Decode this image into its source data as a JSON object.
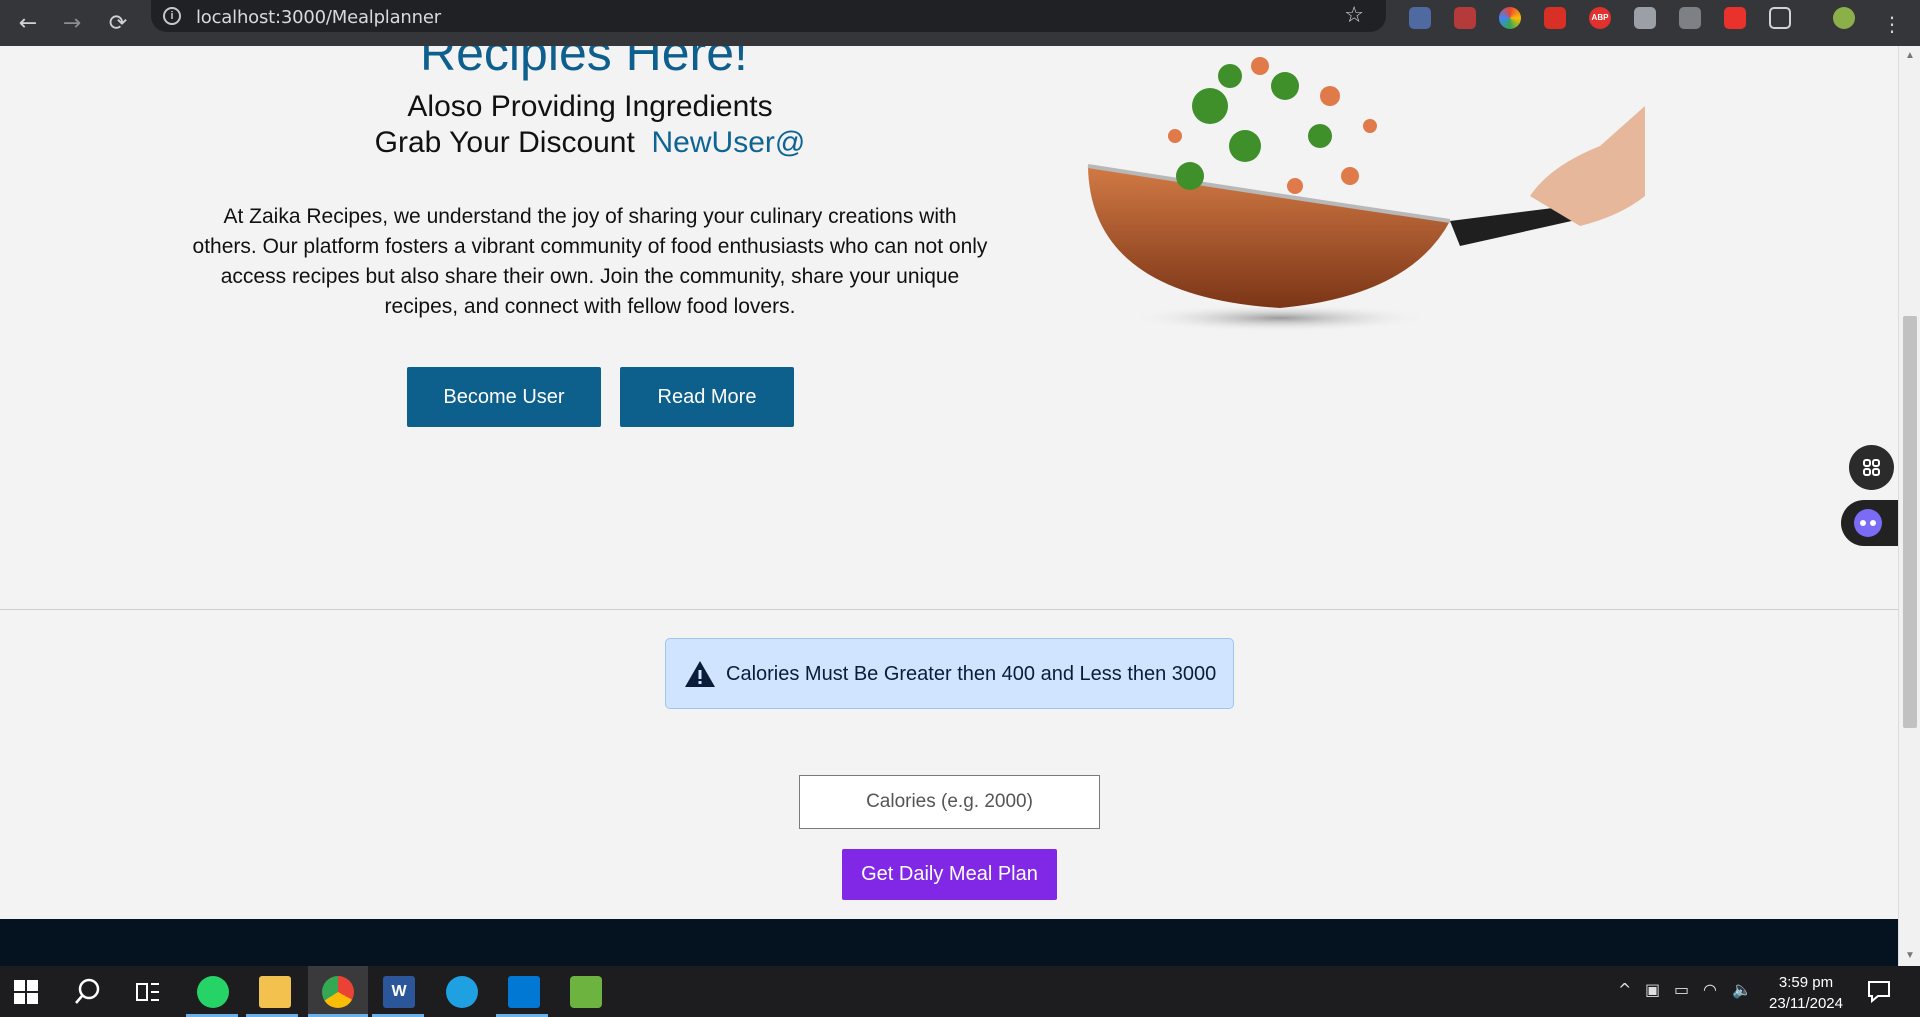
{
  "browser": {
    "url": "localhost:3000/Mealplanner",
    "back_icon": "arrow-left-icon",
    "forward_icon": "arrow-right-icon",
    "reload_icon": "reload-icon",
    "bookmark_icon": "star-icon"
  },
  "hero": {
    "title_partial": "Recipies Here!",
    "subtitle_line1": "Aloso Providing Ingredients",
    "subtitle_line2_prefix": "Grab Your Discount ",
    "subtitle_line2_code": "NewUser@",
    "paragraph": "At Zaika Recipes, we understand the joy of sharing your culinary creations with others. Our platform fosters a vibrant community of food enthusiasts who can not only access recipes but also share their own. Join the community, share your unique recipes, and connect with fellow food lovers.",
    "become_user_label": "Become User",
    "read_more_label": "Read More"
  },
  "meal_planner": {
    "alert_text": "Calories Must Be Greater then 400 and Less then 3000",
    "calories_placeholder": "Calories (e.g. 2000)",
    "button_label": "Get Daily Meal Plan"
  },
  "taskbar": {
    "time": "3:59 pm",
    "date": "23/11/2024"
  },
  "colors": {
    "accent_blue": "#0d5f8c",
    "meal_button": "#8128e6",
    "alert_bg": "#d0e4ff",
    "footer": "#04131f"
  }
}
